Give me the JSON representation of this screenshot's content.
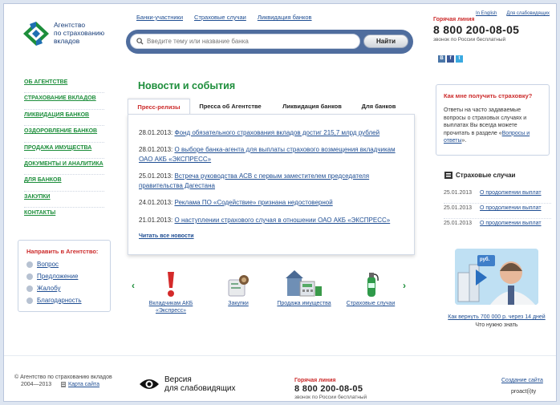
{
  "logo": {
    "line1": "Агентство",
    "line2": "по страхованию",
    "line3": "вкладов"
  },
  "topnav": [
    "Банки-участники",
    "Страховые случаи",
    "Ликвидация банков"
  ],
  "search": {
    "placeholder": "Введите тему или название банка",
    "button": "Найти"
  },
  "lang": {
    "english": "In English",
    "visually_impaired": "Для слабовидящих"
  },
  "hotline": {
    "label": "Горячая линия",
    "number": "8 800 200-08-05",
    "note": "звонок по России бесплатный"
  },
  "social": [
    "В",
    "f",
    "t"
  ],
  "leftnav": [
    "ОБ АГЕНТСТВЕ",
    "СТРАХОВАНИЕ ВКЛАДОВ",
    "ЛИКВИДАЦИЯ БАНКОВ",
    "ОЗДОРОВЛЕНИЕ БАНКОВ",
    "ПРОДАЖА ИМУЩЕСТВА",
    "ДОКУМЕНТЫ И АНАЛИТИКА",
    "ДЛЯ БАНКОВ",
    "ЗАКУПКИ",
    "КОНТАКТЫ"
  ],
  "agency": {
    "title": "Направить в Агентство:",
    "items": [
      "Вопрос",
      "Предложение",
      "Жалобу",
      "Благодарность"
    ]
  },
  "news": {
    "title": "Новости и события",
    "tabs": [
      "Пресс-релизы",
      "Пресса об Агентстве",
      "Ликвидация банков",
      "Для банков"
    ],
    "items": [
      {
        "date": "28.01.2013:",
        "text": "Фонд обязательного страхования вкладов достиг 215,7 млрд рублей"
      },
      {
        "date": "28.01.2013:",
        "text": "О выборе банка-агента для выплаты страхового возмещения вкладчикам ОАО АКБ «ЭКСПРЕСС»"
      },
      {
        "date": "25.01.2013:",
        "text": "Встреча руководства АСВ с первым заместителем председателя правительства Дагестана"
      },
      {
        "date": "24.01.2013:",
        "text": "Реклама ПО «Содействие» признана недостоверной"
      },
      {
        "date": "21.01.2013:",
        "text": "О наступлении страхового случая в отношении ОАО АКБ «ЭКСПРЕСС»"
      }
    ],
    "read_all": "Читать все новости"
  },
  "carousel": [
    {
      "label": "Вкладчикам АКБ «Экспресс»",
      "icon": "exclamation-icon"
    },
    {
      "label": "Закупки",
      "icon": "purchases-icon"
    },
    {
      "label": "Продажа имущества",
      "icon": "property-icon"
    },
    {
      "label": "Страховые случаи",
      "icon": "extinguisher-icon"
    }
  ],
  "faq": {
    "title": "Как мне получить страховку?",
    "text": "Ответы на часто задаваемые вопросы о страховых случаях и выплатах Вы всегда можете прочитать в разделе «",
    "link": "Вопросы и ответы",
    "tail": "»."
  },
  "insurance": {
    "title": "Страховые случаи",
    "rows": [
      {
        "date": "25.01.2013",
        "text": "О продолжении выплат"
      },
      {
        "date": "25.01.2013",
        "text": "О продолжении выплат"
      },
      {
        "date": "25.01.2013",
        "text": "О продолжении выплат"
      }
    ]
  },
  "promo": {
    "badge": "руб.",
    "link": "Как вернуть 700 000 р. через 14 дней",
    "sub": "Что нужно знать"
  },
  "footer": {
    "copyright": "© Агентство по страхованию вкладов",
    "years": "2004—2013",
    "sitemap": "Карта сайта",
    "version_line1": "Версия",
    "version_line2": "для слабовидящих",
    "site_creation": "Создание сайта",
    "proactivity": "proact(i)ty"
  },
  "colors": {
    "green": "#1d8e3b",
    "red": "#cc2b2b",
    "link": "#1f4e93",
    "search_bar": "#4f6d9e"
  }
}
